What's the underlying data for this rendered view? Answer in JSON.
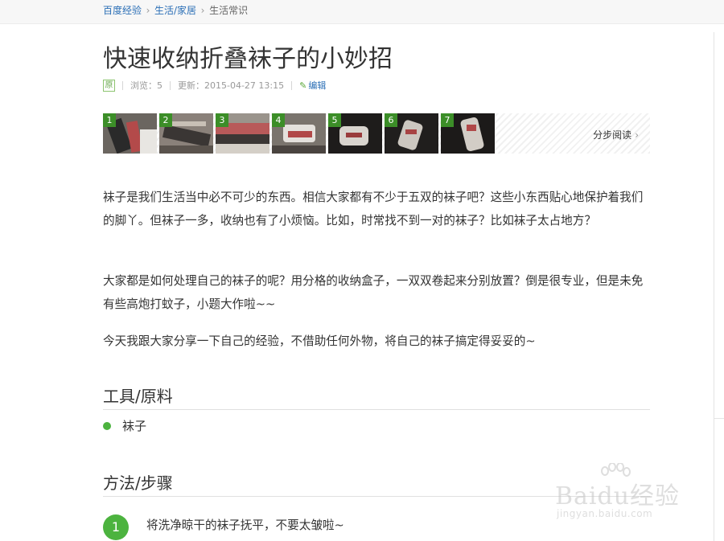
{
  "breadcrumb": {
    "items": [
      {
        "label": "百度经验"
      },
      {
        "label": "生活/家居"
      }
    ],
    "current": "生活常识"
  },
  "article": {
    "title": "快速收纳折叠袜子的小妙招",
    "meta": {
      "badge": "原",
      "views": "浏览：5",
      "updated": "更新：2015-04-27 13:15",
      "edit": "编辑"
    }
  },
  "steps_strip": {
    "thumbs": [
      {
        "num": "1"
      },
      {
        "num": "2"
      },
      {
        "num": "3"
      },
      {
        "num": "4"
      },
      {
        "num": "5"
      },
      {
        "num": "6"
      },
      {
        "num": "7"
      }
    ],
    "read_label": "分步阅读",
    "read_icon": "chevron-right-icon"
  },
  "intro": [
    "袜子是我们生活当中必不可少的东西。相信大家都有不少于五双的袜子吧？这些小东西贴心地保护着我们的脚丫。但袜子一多，收纳也有了小烦恼。比如，时常找不到一对的袜子？比如袜子太占地方？",
    "大家都是如何处理自己的袜子的呢？用分格的收纳盒子，一双双卷起来分别放置？倒是很专业，但是未免有些高炮打蚊子，小题大作啦~~",
    "今天我跟大家分享一下自己的经验，不借助任何外物，将自己的袜子搞定得妥妥的~"
  ],
  "tools": {
    "heading": "工具/原料",
    "items": [
      "袜子"
    ]
  },
  "method": {
    "heading": "方法/步骤",
    "steps": [
      {
        "num": "1",
        "text": "将洗净晾干的袜子抚平，不要太皱啦~"
      }
    ]
  },
  "watermark": {
    "brand": "Baidu经验",
    "url": "jingyan.baidu.com"
  },
  "colors": {
    "link": "#2b6fb6",
    "green": "#4cb33f",
    "badge_green": "#3c8e28"
  }
}
